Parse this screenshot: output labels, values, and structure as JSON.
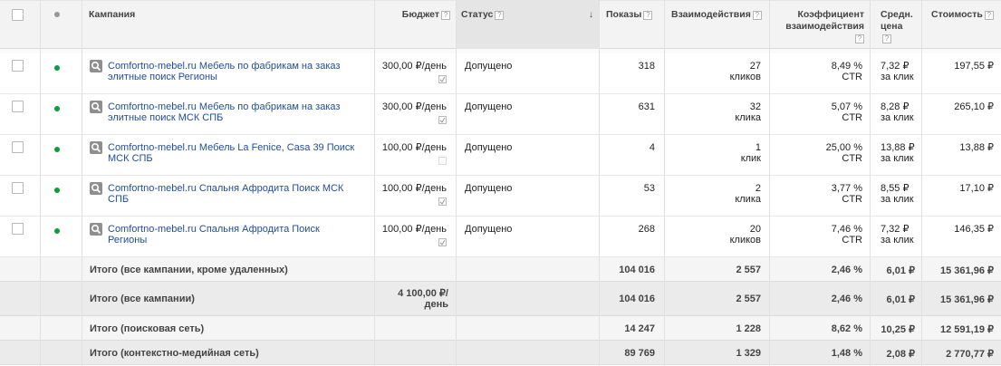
{
  "header": {
    "campaign": "Кампания",
    "budget": "Бюджет",
    "status": "Статус",
    "impressions": "Показы",
    "interactions": "Взаимодействия",
    "rate_line1": "Коэффициент",
    "rate_line2": "взаимодействия",
    "avg_line1": "Средн.",
    "avg_line2": "цена",
    "cost": "Стоимость",
    "help_glyph": "?",
    "sort_arrow": "↓"
  },
  "rows": [
    {
      "name_line1": "Comfortno-mebel.ru Мебель по фабрикам на заказ",
      "name_line2": "элитные поиск Регионы",
      "budget": "300,00 ₽/день",
      "status": "Допущено",
      "impressions": "318",
      "interactions": "27",
      "interactions_unit": "кликов",
      "rate": "8,49 %",
      "rate_unit": "CTR",
      "avg": "7,32 ₽",
      "avg_unit": "за клик",
      "cost": "197,55 ₽"
    },
    {
      "name_line1": "Comfortno-mebel.ru Мебель по фабрикам на заказ",
      "name_line2": "элитные поиск МСК СПБ",
      "budget": "300,00 ₽/день",
      "status": "Допущено",
      "impressions": "631",
      "interactions": "32",
      "interactions_unit": "клика",
      "rate": "5,07 %",
      "rate_unit": "CTR",
      "avg": "8,28 ₽",
      "avg_unit": "за клик",
      "cost": "265,10 ₽"
    },
    {
      "name_line1": "Comfortno-mebel.ru Мебель La Fenice, Casa 39 Поиск",
      "name_line2": "МСК СПБ",
      "budget": "100,00 ₽/день",
      "status": "Допущено",
      "impressions": "4",
      "interactions": "1",
      "interactions_unit": "клик",
      "rate": "25,00 %",
      "rate_unit": "CTR",
      "avg": "13,88 ₽",
      "avg_unit": "за клик",
      "cost": "13,88 ₽"
    },
    {
      "name_line1": "Comfortno-mebel.ru Спальня Афродита Поиск МСК",
      "name_line2": "СПБ",
      "budget": "100,00 ₽/день",
      "status": "Допущено",
      "impressions": "53",
      "interactions": "2",
      "interactions_unit": "клика",
      "rate": "3,77 %",
      "rate_unit": "CTR",
      "avg": "8,55 ₽",
      "avg_unit": "за клик",
      "cost": "17,10 ₽"
    },
    {
      "name_line1": "Comfortno-mebel.ru Спальня Афродита Поиск",
      "name_line2": "Регионы",
      "budget": "100,00 ₽/день",
      "status": "Допущено",
      "impressions": "268",
      "interactions": "20",
      "interactions_unit": "кликов",
      "rate": "7,46 %",
      "rate_unit": "CTR",
      "avg": "7,32 ₽",
      "avg_unit": "за клик",
      "cost": "146,35 ₽"
    }
  ],
  "totals": [
    {
      "label": "Итого (все кампании, кроме удаленных)",
      "budget_line1": "",
      "budget_line2": "",
      "impressions": "104 016",
      "interactions": "2 557",
      "rate": "2,46 %",
      "avg": "6,01 ₽",
      "cost": "15 361,96 ₽"
    },
    {
      "label": "Итого (все кампании)",
      "budget_line1": "4 100,00 ₽/",
      "budget_line2": "день",
      "impressions": "104 016",
      "interactions": "2 557",
      "rate": "2,46 %",
      "avg": "6,01 ₽",
      "cost": "15 361,96 ₽"
    },
    {
      "label": "Итого (поисковая сеть)",
      "budget_line1": "",
      "budget_line2": "",
      "impressions": "14 247",
      "interactions": "1 228",
      "rate": "8,62 %",
      "avg": "10,25 ₽",
      "cost": "12 591,19 ₽"
    },
    {
      "label": "Итого (контекстно-медийная сеть)",
      "budget_line1": "",
      "budget_line2": "",
      "impressions": "89 769",
      "interactions": "1 329",
      "rate": "1,48 %",
      "avg": "2,08 ₽",
      "cost": "2 770,77 ₽"
    }
  ],
  "colors": {
    "link": "#1f4d99",
    "status_enabled": "#0b9c3c",
    "header_bg": "#f3f3f3",
    "total_bg": "#f5f5f5",
    "total_all_bg": "#ebebeb"
  },
  "icons": {
    "campaign_type": "search-campaign-icon",
    "budget_edit": "edit-budget-icon",
    "status": "status-dot-icon"
  }
}
